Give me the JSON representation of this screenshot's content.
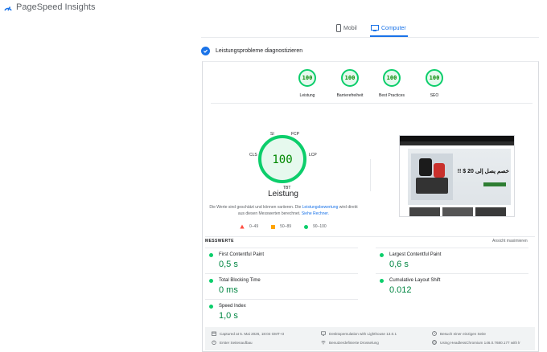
{
  "app": {
    "title": "PageSpeed Insights"
  },
  "tabs": [
    {
      "label": "Mobil"
    },
    {
      "label": "Computer"
    }
  ],
  "diagnose": {
    "title": "Leistungsprobleme diagnostizieren"
  },
  "categories": [
    {
      "score": "100",
      "label": "Leistung"
    },
    {
      "score": "100",
      "label": "Barrierefreiheit"
    },
    {
      "score": "100",
      "label": "Best Practices"
    },
    {
      "score": "100",
      "label": "SEO"
    }
  ],
  "main_gauge": {
    "score": "100",
    "label": "Leistung",
    "axis": {
      "si": "SI",
      "fcp": "FCP",
      "lcp": "LCP",
      "tbt": "TBT",
      "cls": "CLS"
    }
  },
  "note": {
    "part1": "Die Werte sind geschätzt und können variieren. Die ",
    "link1": "Leistungsbewertung",
    "part2": " wird direkt aus diesen Messwerten berechnet. ",
    "link2": "Siehe Rechner."
  },
  "legend": [
    {
      "range": "0–49"
    },
    {
      "range": "50–89"
    },
    {
      "range": "90–100"
    }
  ],
  "screenshot": {
    "headline": "خصم يصل إلى 20 $ !!",
    "button": ""
  },
  "metrics": {
    "title": "MESSWERTE",
    "expand": "Ansicht maximieren",
    "items": [
      {
        "name": "First Contentful Paint",
        "value": "0,5 s"
      },
      {
        "name": "Largest Contentful Paint",
        "value": "0,6 s"
      },
      {
        "name": "Total Blocking Time",
        "value": "0 ms"
      },
      {
        "name": "Cumulative Layout Shift",
        "value": "0.012"
      },
      {
        "name": "Speed Index",
        "value": "1,0 s"
      }
    ]
  },
  "footer": {
    "captured": "Captured at 5. Mai 2026, 18:04 GMT+3",
    "emulation": "Desktopemulation with Lighthouse 13.0.1",
    "visit": "Besuch einer einzigen Seite",
    "load": "Erster Seitenaufbau",
    "throttle": "Benutzerdefinierte Drosselung",
    "browser": "Using HeadlessChromium 146.0.7680.177 with lr"
  },
  "colors": {
    "pass": "#0cce6b",
    "average": "#ffa400",
    "fail": "#ff4e42",
    "accent": "#1a73e8"
  }
}
